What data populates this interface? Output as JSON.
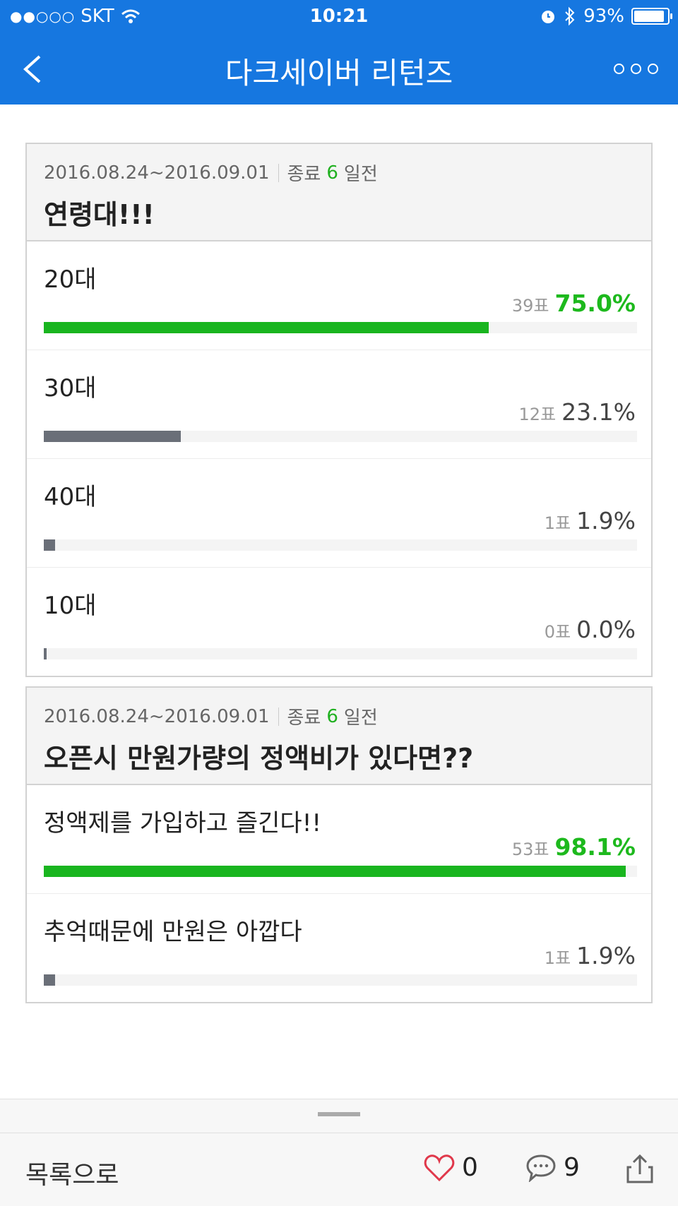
{
  "status_bar": {
    "carrier": "SKT",
    "signal_dots": "●●○○○",
    "time": "10:21",
    "battery": "93%"
  },
  "header": {
    "title": "다크세이버 리턴즈"
  },
  "polls": [
    {
      "date_range": "2016.08.24~2016.09.01",
      "end_prefix": "종료",
      "days": "6",
      "end_suffix": "일전",
      "question": "연령대!!!",
      "options": [
        {
          "label": "20대",
          "votes": "39표",
          "percent": "75.0%",
          "fraction": 0.75,
          "winner": true
        },
        {
          "label": "30대",
          "votes": "12표",
          "percent": "23.1%",
          "fraction": 0.231,
          "winner": false
        },
        {
          "label": "40대",
          "votes": "1표",
          "percent": "1.9%",
          "fraction": 0.019,
          "winner": false
        },
        {
          "label": "10대",
          "votes": "0표",
          "percent": "0.0%",
          "fraction": 0.0,
          "winner": false
        }
      ]
    },
    {
      "date_range": "2016.08.24~2016.09.01",
      "end_prefix": "종료",
      "days": "6",
      "end_suffix": "일전",
      "question": "오픈시 만원가량의 정액비가 있다면??",
      "options": [
        {
          "label": "정액제를 가입하고 즐긴다!!",
          "votes": "53표",
          "percent": "98.1%",
          "fraction": 0.981,
          "winner": true
        },
        {
          "label": "추억때문에 만원은 아깝다",
          "votes": "1표",
          "percent": "1.9%",
          "fraction": 0.019,
          "winner": false
        }
      ]
    }
  ],
  "toolbar": {
    "list_label": "목록으로",
    "like_count": "0",
    "comment_count": "9"
  },
  "colors": {
    "header_blue": "#1677e0",
    "winner_green": "#19b51f",
    "loser_gray": "#6a6f78"
  },
  "icons": [
    "back-chevron-icon",
    "more-icon",
    "wifi-icon",
    "alarm-icon",
    "bluetooth-icon",
    "heart-icon",
    "comment-icon",
    "share-icon"
  ]
}
